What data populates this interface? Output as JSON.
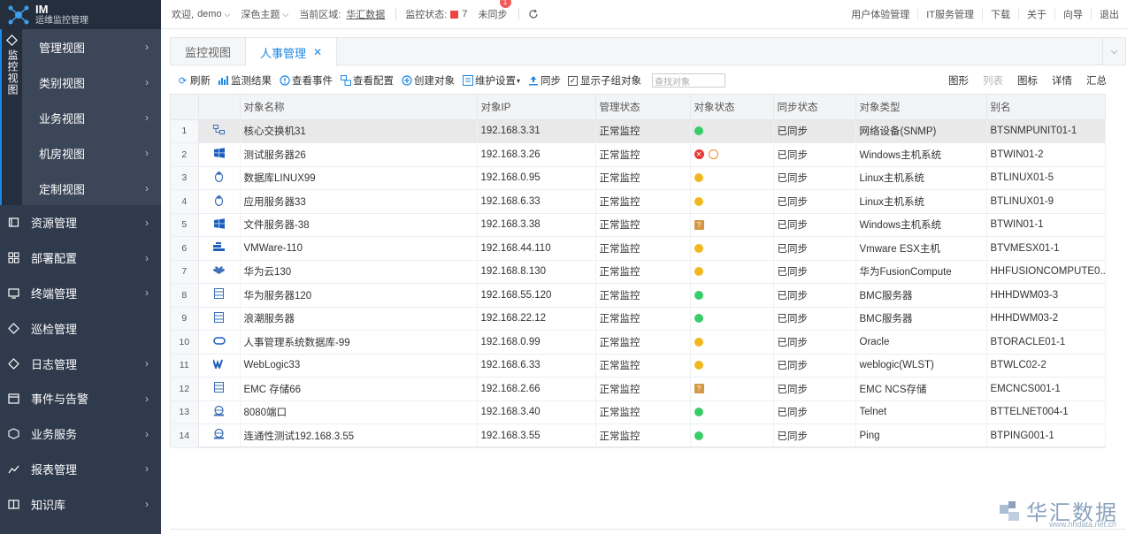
{
  "app": {
    "title": "IM",
    "subtitle": "运维监控管理"
  },
  "sidebar": {
    "active_section": "监控视图",
    "subnav": [
      {
        "label": "管理视图"
      },
      {
        "label": "类别视图"
      },
      {
        "label": "业务视图"
      },
      {
        "label": "机房视图"
      },
      {
        "label": "定制视图"
      }
    ],
    "items": [
      {
        "label": "资源管理",
        "icon": "resource-icon"
      },
      {
        "label": "部署配置",
        "icon": "grid-icon"
      },
      {
        "label": "终端管理",
        "icon": "terminal-icon"
      },
      {
        "label": "巡检管理",
        "icon": "inspect-icon"
      },
      {
        "label": "日志管理",
        "icon": "log-icon"
      },
      {
        "label": "事件与告警",
        "icon": "calendar-icon"
      },
      {
        "label": "业务服务",
        "icon": "box-icon"
      },
      {
        "label": "报表管理",
        "icon": "chart-icon"
      },
      {
        "label": "知识库",
        "icon": "book-icon"
      }
    ]
  },
  "topbar": {
    "welcome": "欢迎,",
    "user": "demo",
    "theme": "深色主题",
    "region_label": "当前区域:",
    "region_value": "华汇数据",
    "monitor_label": "监控状态:",
    "monitor_count": "7",
    "unsync": "未同步",
    "unsync_badge": "1",
    "right_links": [
      "用户体验管理",
      "IT服务管理",
      "下载",
      "关于",
      "向导",
      "退出"
    ]
  },
  "tabs": [
    {
      "label": "监控视图",
      "active": false
    },
    {
      "label": "人事管理",
      "active": true
    }
  ],
  "toolbar": {
    "refresh": "刷新",
    "results": "监测结果",
    "events": "查看事件",
    "config": "查看配置",
    "create": "创建对象",
    "maintain": "维护设置",
    "sync": "同步",
    "show_children": "显示子组对象",
    "search_placeholder": "查找对象",
    "views": [
      {
        "label": "图形",
        "disabled": false
      },
      {
        "label": "列表",
        "disabled": true
      },
      {
        "label": "图标",
        "disabled": false
      },
      {
        "label": "详情",
        "disabled": false
      },
      {
        "label": "汇总",
        "disabled": false
      }
    ]
  },
  "table": {
    "columns": [
      "对象名称",
      "对象IP",
      "管理状态",
      "对象状态",
      "同步状态",
      "对象类型",
      "别名"
    ],
    "rows": [
      {
        "no": "1",
        "icon": "switch-icon",
        "name": "核心交换机31",
        "ip": "192.168.3.31",
        "mgmt": "正常监控",
        "status": "green",
        "sync": "已同步",
        "type": "网络设备(SNMP)",
        "alias": "BTSNMPUNIT01-1"
      },
      {
        "no": "2",
        "icon": "windows-icon",
        "name": "测试服务器26",
        "ip": "192.168.3.26",
        "mgmt": "正常监控",
        "status": "error",
        "sync": "已同步",
        "type": "Windows主机系统",
        "alias": "BTWIN01-2"
      },
      {
        "no": "3",
        "icon": "linux-icon",
        "name": "数据库LINUX99",
        "ip": "192.168.0.95",
        "mgmt": "正常监控",
        "status": "yellow",
        "sync": "已同步",
        "type": "Linux主机系统",
        "alias": "BTLINUX01-5"
      },
      {
        "no": "4",
        "icon": "linux-icon",
        "name": "应用服务器33",
        "ip": "192.168.6.33",
        "mgmt": "正常监控",
        "status": "yellow",
        "sync": "已同步",
        "type": "Linux主机系统",
        "alias": "BTLINUX01-9"
      },
      {
        "no": "5",
        "icon": "windows-icon",
        "name": "文件服务器-38",
        "ip": "192.168.3.38",
        "mgmt": "正常监控",
        "status": "unknown",
        "sync": "已同步",
        "type": "Windows主机系统",
        "alias": "BTWIN01-1"
      },
      {
        "no": "6",
        "icon": "vmware-icon",
        "name": "VMWare-110",
        "ip": "192.168.44.110",
        "mgmt": "正常监控",
        "status": "yellow",
        "sync": "已同步",
        "type": "Vmware ESX主机",
        "alias": "BTVMESX01-1"
      },
      {
        "no": "7",
        "icon": "huawei-icon",
        "name": "华为云130",
        "ip": "192.168.8.130",
        "mgmt": "正常监控",
        "status": "yellow",
        "sync": "已同步",
        "type": "华为FusionCompute",
        "alias": "HHFUSIONCOMPUTE0..."
      },
      {
        "no": "8",
        "icon": "server-icon",
        "name": "华为服务器120",
        "ip": "192.168.55.120",
        "mgmt": "正常监控",
        "status": "green",
        "sync": "已同步",
        "type": "BMC服务器",
        "alias": "HHHDWM03-3"
      },
      {
        "no": "9",
        "icon": "server-icon",
        "name": "浪潮服务器",
        "ip": "192.168.22.12",
        "mgmt": "正常监控",
        "status": "green",
        "sync": "已同步",
        "type": "BMC服务器",
        "alias": "HHHDWM03-2"
      },
      {
        "no": "10",
        "icon": "oracle-icon",
        "name": "人事管理系统数据库-99",
        "ip": "192.168.0.99",
        "mgmt": "正常监控",
        "status": "yellow",
        "sync": "已同步",
        "type": "Oracle",
        "alias": "BTORACLE01-1"
      },
      {
        "no": "11",
        "icon": "weblogic-icon",
        "name": "WebLogic33",
        "ip": "192.168.6.33",
        "mgmt": "正常监控",
        "status": "yellow",
        "sync": "已同步",
        "type": "weblogic(WLST)",
        "alias": "BTWLC02-2"
      },
      {
        "no": "12",
        "icon": "storage-icon",
        "name": "EMC 存储66",
        "ip": "192.168.2.66",
        "mgmt": "正常监控",
        "status": "unknown",
        "sync": "已同步",
        "type": "EMC NCS存储",
        "alias": "EMCNCS001-1"
      },
      {
        "no": "13",
        "icon": "port-icon",
        "name": "8080端口",
        "ip": "192.168.3.40",
        "mgmt": "正常监控",
        "status": "green",
        "sync": "已同步",
        "type": "Telnet",
        "alias": "BTTELNET004-1"
      },
      {
        "no": "14",
        "icon": "port-icon",
        "name": "连通性测试192.168.3.55",
        "ip": "192.168.3.55",
        "mgmt": "正常监控",
        "status": "green",
        "sync": "已同步",
        "type": "Ping",
        "alias": "BTPING001-1"
      }
    ]
  },
  "watermark": {
    "cn": "华汇数据",
    "url": "www.hhdata.net.cn"
  },
  "colors": {
    "sidebar_bg": "#2f3a4c",
    "accent": "#1e88e5",
    "status_green": "#38cc6a",
    "status_yellow": "#f0b81e",
    "status_red": "#e53935"
  }
}
